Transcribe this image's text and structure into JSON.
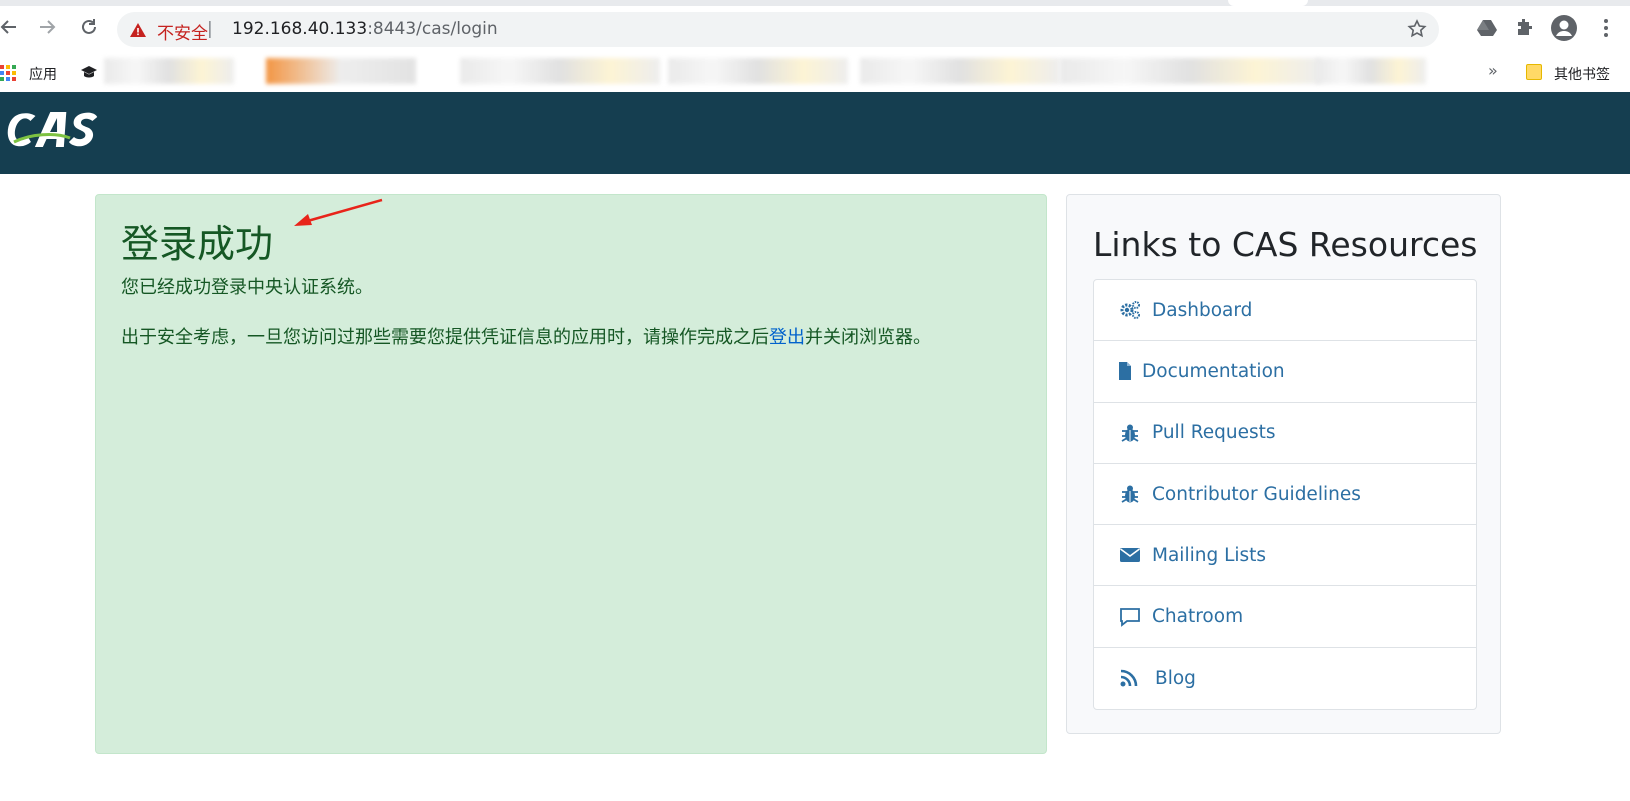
{
  "browser": {
    "security_label": "不安全",
    "separator": "|",
    "url_host": "192.168.40.133",
    "url_path": ":8443/cas/login"
  },
  "bookmarks": {
    "apps_label": "应用",
    "other_label": "其他书签",
    "more": "»"
  },
  "success": {
    "title": "登录成功",
    "message": "您已经成功登录中央认证系统。",
    "warning_before": "出于安全考虑，一旦您访问过那些需要您提供凭证信息的应用时，请操作完成之后",
    "logout_link": "登出",
    "warning_after": "并关闭浏览器。"
  },
  "resources": {
    "title": "Links to CAS Resources",
    "items": [
      {
        "label": "Dashboard",
        "icon": "cogs-icon"
      },
      {
        "label": "Documentation",
        "icon": "file-icon"
      },
      {
        "label": "Pull Requests",
        "icon": "bug-icon"
      },
      {
        "label": "Contributor Guidelines",
        "icon": "bug-icon"
      },
      {
        "label": "Mailing Lists",
        "icon": "envelope-icon"
      },
      {
        "label": "Chatroom",
        "icon": "comment-icon"
      },
      {
        "label": "Blog",
        "icon": "rss-icon"
      }
    ]
  },
  "colors": {
    "header_bg": "#153e50",
    "success_bg": "#d4edda",
    "success_text": "#155724",
    "link": "#2c6fa3",
    "annotation_arrow": "#e8241a"
  }
}
